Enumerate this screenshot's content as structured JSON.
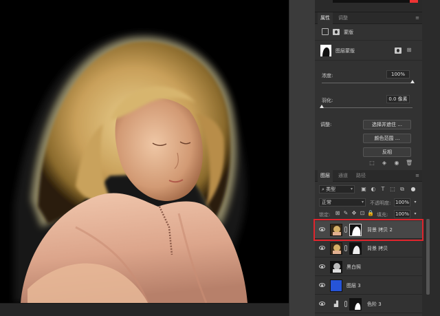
{
  "colors": {
    "app_bg": "#1e1e1e",
    "panel_bg": "#323232",
    "selected_row": "#474747",
    "highlight": "#e0252d",
    "blue_fill_layer": "#2654d8"
  },
  "properties_panel": {
    "tabs": [
      {
        "label": "属性",
        "active": true
      },
      {
        "label": "调整",
        "active": false
      }
    ],
    "mode_label": "蒙版",
    "mask_type_label": "图层蒙版",
    "density_label": "浓度:",
    "density_value": "100%",
    "density": 1.0,
    "feather_label": "羽化:",
    "feather_value": "0.0 像素",
    "feather": 0.0,
    "refine_label": "调整:",
    "buttons": [
      "选择并遮住 ...",
      "颜色范围 ...",
      "反相"
    ]
  },
  "layers_panel": {
    "tabs": [
      {
        "label": "图层",
        "active": true
      },
      {
        "label": "通道",
        "active": false
      },
      {
        "label": "路径",
        "active": false
      }
    ],
    "filter_kind": "类型",
    "blend_mode": "正常",
    "opacity_label": "不透明度:",
    "opacity_value": "100%",
    "lock_label": "锁定:",
    "fill_label": "填充:",
    "fill_value": "100%",
    "layers": [
      {
        "name": "背景 拷贝 2",
        "type": "photo-with-mask",
        "visible": true,
        "selected": true
      },
      {
        "name": "背景 拷贝",
        "type": "photo-with-mask",
        "visible": true,
        "selected": false
      },
      {
        "name": "黑白照",
        "type": "bw-photo",
        "visible": true,
        "selected": false
      },
      {
        "name": "图层 3",
        "type": "solid-blue",
        "visible": true,
        "selected": false
      },
      {
        "name": "色阶 3",
        "type": "levels-adjustment",
        "visible": true,
        "selected": false
      }
    ]
  }
}
